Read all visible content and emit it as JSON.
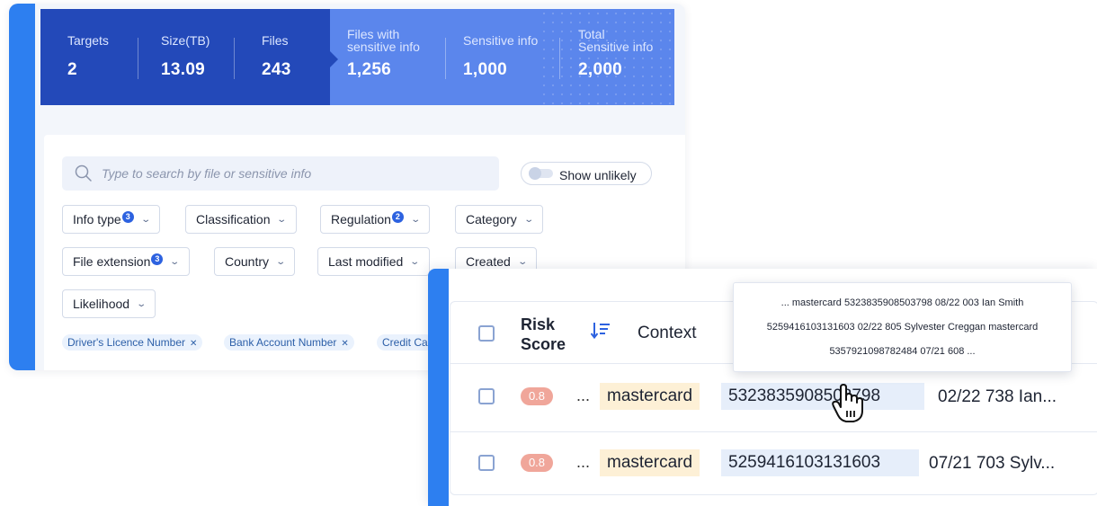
{
  "stats": {
    "targets": {
      "label": "Targets",
      "value": "2"
    },
    "size": {
      "label": "Size(TB)",
      "value": "13.09"
    },
    "files": {
      "label": "Files",
      "value": "243"
    },
    "files_sensitive": {
      "label_line1": "Files with",
      "label_line2": "sensitive info",
      "value": "1,256"
    },
    "sensitive": {
      "label": "Sensitive info",
      "value": "1,000"
    },
    "total": {
      "label_line1": "Total",
      "label_line2": "Sensitive info",
      "value": "2,000"
    }
  },
  "search": {
    "placeholder": "Type to search by file or sensitive info"
  },
  "toggle": {
    "label": "Show unlikely"
  },
  "filters": {
    "info_type": {
      "label": "Info type",
      "badge": "3"
    },
    "classification": {
      "label": "Classification"
    },
    "regulation": {
      "label": "Regulation",
      "badge": "2"
    },
    "category": {
      "label": "Category"
    },
    "file_extension": {
      "label": "File extension",
      "badge": "3"
    },
    "country": {
      "label": "Country"
    },
    "last_modified": {
      "label": "Last modified"
    },
    "created": {
      "label": "Created"
    },
    "likelihood": {
      "label": "Likelihood"
    }
  },
  "tags": [
    "Driver's Licence Number",
    "Bank Account Number",
    "Credit Ca"
  ],
  "table": {
    "header": {
      "risk_line1": "Risk",
      "risk_line2": "Score",
      "context": "Context"
    },
    "rows": [
      {
        "risk": "0.8",
        "ellipsis": "...",
        "keyword": "mastercard",
        "number": "5323835908503798",
        "rest": "02/22 738 Ian..."
      },
      {
        "risk": "0.8",
        "ellipsis": "...",
        "keyword": "mastercard",
        "number": "5259416103131603",
        "rest": "07/21 703 Sylv..."
      }
    ]
  },
  "tooltip": {
    "line1": "... mastercard 5323835908503798 08/22 003 Ian Smith",
    "line2": "5259416103131603 02/22 805 Sylvester Creggan mastercard",
    "line3": "5357921098782484 07/21 608 ..."
  },
  "colors": {
    "accent": "#2d7ff0",
    "stats_dark": "#2349b9",
    "stats_light": "#5b86ec",
    "risk": "#f0a69a"
  }
}
